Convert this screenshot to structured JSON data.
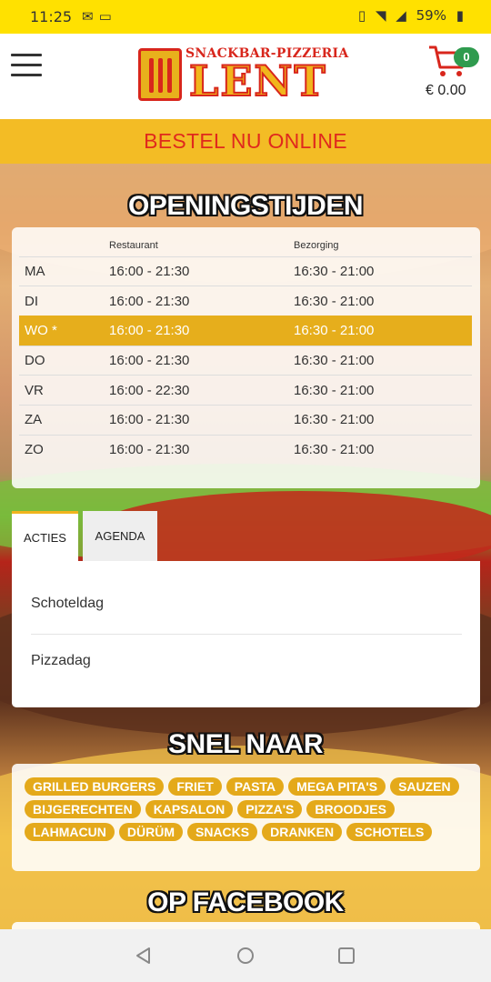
{
  "status_bar": {
    "time": "11:25",
    "left_icons": [
      "mail-icon",
      "laptop-icon"
    ],
    "right_icons": [
      "vibrate-icon",
      "wifi-icon",
      "signal-icon"
    ],
    "battery": "59%"
  },
  "header": {
    "logo_subtitle": "SNACKBAR-PIZZERIA",
    "logo_title": "LENT",
    "cart_count": "0",
    "cart_total": "€ 0.00"
  },
  "order_banner": "BESTEL NU ONLINE",
  "hours": {
    "title": "OPENINGSTIJDEN",
    "columns": [
      "",
      "Restaurant",
      "Bezorging"
    ],
    "rows": [
      {
        "day": "MA",
        "restaurant": "16:00 - 21:30",
        "delivery": "16:30 - 21:00"
      },
      {
        "day": "DI",
        "restaurant": "16:00 - 21:30",
        "delivery": "16:30 - 21:00"
      },
      {
        "day": "WO *",
        "restaurant": "16:00 - 21:30",
        "delivery": "16:30 - 21:00"
      },
      {
        "day": "DO",
        "restaurant": "16:00 - 21:30",
        "delivery": "16:30 - 21:00"
      },
      {
        "day": "VR",
        "restaurant": "16:00 - 22:30",
        "delivery": "16:30 - 21:00"
      },
      {
        "day": "ZA",
        "restaurant": "16:00 - 21:30",
        "delivery": "16:30 - 21:00"
      },
      {
        "day": "ZO",
        "restaurant": "16:00 - 21:30",
        "delivery": "16:30 - 21:00"
      }
    ]
  },
  "tabs": {
    "items": [
      "ACTIES",
      "AGENDA"
    ],
    "entries": [
      "Schoteldag",
      "Pizzadag"
    ]
  },
  "quick_links": {
    "title": "SNEL NAAR",
    "rows": [
      [
        "GRILLED BURGERS",
        "FRIET",
        "PASTA",
        "MEGA PITA'S",
        "SAUZEN"
      ],
      [
        "BIJGERECHTEN",
        "KAPSALON",
        "PIZZA'S",
        "BROODJES"
      ],
      [
        "LAHMACUN",
        "DÜRÜM",
        "SNACKS",
        "DRANKEN",
        "SCHOTELS"
      ]
    ]
  },
  "facebook_title": "OP FACEBOOK",
  "colors": {
    "status_bar": "#ffe100",
    "accent": "#f3bc25",
    "brand_red": "#e0291d",
    "chip": "#e4a91a",
    "active_row": "#e6ae1c",
    "cart_badge": "#2f9b4e"
  },
  "nav_bar": [
    "back-icon",
    "home-icon",
    "recent-apps-icon"
  ]
}
